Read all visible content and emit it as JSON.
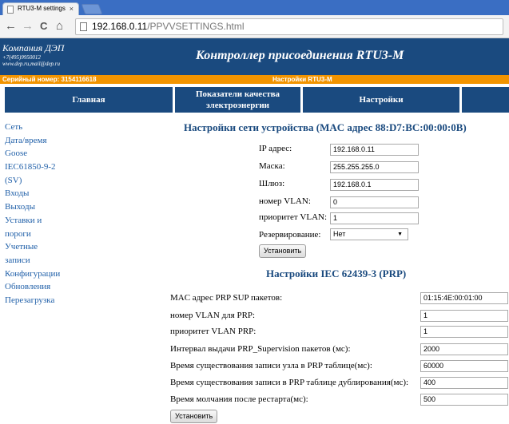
{
  "browser": {
    "tab_title": "RTU3-M settings",
    "tab_close": "×",
    "back": "←",
    "forward": "→",
    "reload": "C",
    "home": "⌂",
    "url_host": "192.168.0.11",
    "url_path": "/PPVVSETTINGS.html"
  },
  "header": {
    "company": "Компания ДЭП",
    "company_phone": "+7(495)9950012",
    "company_web": "www.dep.ru,mail@dep.ru",
    "title": "Контроллер присоединения RTU3-M",
    "serial": "Серийный номер: 3154116618",
    "subtitle": "Настройки RTU3-M"
  },
  "menu": {
    "main": "Главная",
    "power_quality_line1": "Показатели качества",
    "power_quality_line2": "электроэнергии",
    "settings": "Настройки"
  },
  "sidebar": {
    "items": [
      {
        "label": "Сеть"
      },
      {
        "label": "Дата/время"
      },
      {
        "label": "Goose"
      },
      {
        "label": "IEC61850-9-2"
      },
      {
        "label": "(SV)"
      },
      {
        "label": "Входы"
      },
      {
        "label": "Выходы"
      },
      {
        "label": "Уставки и"
      },
      {
        "label": "пороги"
      },
      {
        "label": "Учетные"
      },
      {
        "label": "записи"
      },
      {
        "label": "Конфигурации"
      },
      {
        "label": "Обновления"
      },
      {
        "label": "Перезагрузка"
      }
    ]
  },
  "network": {
    "title": "Настройки сети устройства (MAC адрес 88:D7:BC:00:00:0B)",
    "ip_label": "IP адрес:",
    "ip_value": "192.168.0.11",
    "mask_label": "Маска:",
    "mask_value": "255.255.255.0",
    "gateway_label": "Шлюз:",
    "gateway_value": "192.168.0.1",
    "vlan_label": "номер VLAN:",
    "vlan_value": "0",
    "vlan_prio_label": "приоритет VLAN:",
    "vlan_prio_value": "1",
    "redundancy_label": "Резервирование:",
    "redundancy_value": "Нет",
    "redundancy_arrow": "▼",
    "submit": "Установить"
  },
  "prp": {
    "title": "Настройки IEC 62439-3 (PRP)",
    "rows": [
      {
        "label": "MAC адрес PRP SUP пакетов:",
        "value": "01:15:4E:00:01:00"
      },
      {
        "label": "номер VLAN для PRP:",
        "value": "1"
      },
      {
        "label": "приоритет VLAN PRP:",
        "value": "1"
      },
      {
        "label": "Интервал выдачи PRP_Supervision пакетов (мс):",
        "value": "2000"
      },
      {
        "label": "Время существования записи узла в PRP таблице(мс):",
        "value": "60000"
      },
      {
        "label": "Время существования записи в PRP таблице дублирования(мс):",
        "value": "400"
      },
      {
        "label": "Время молчания после рестарта(мс):",
        "value": "500"
      }
    ],
    "submit": "Установить"
  }
}
